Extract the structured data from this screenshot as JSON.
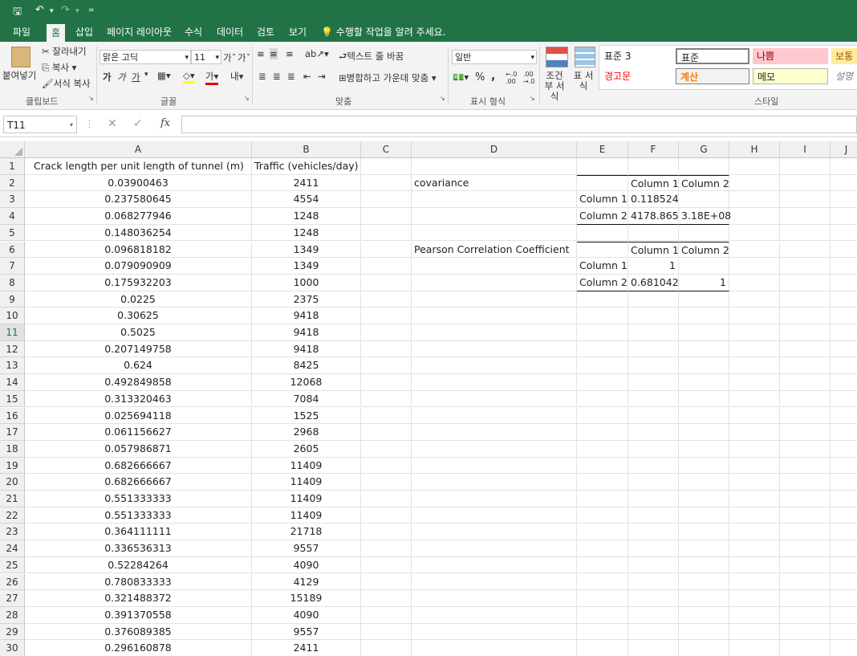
{
  "qat": {
    "save": "🖫",
    "undo": "↶",
    "redo": "↷"
  },
  "tabs": [
    "파일",
    "홈",
    "삽입",
    "페이지 레이아웃",
    "수식",
    "데이터",
    "검토",
    "보기"
  ],
  "tell_me": "수행할 작업을 알려 주세요.",
  "ribbon": {
    "clipboard": {
      "paste": "붙여넣기",
      "cut": "잘라내기",
      "copy": "복사",
      "format_painter": "서식 복사",
      "label": "클립보드"
    },
    "font": {
      "name": "맑은 고딕",
      "size": "11",
      "bold": "가",
      "italic": "가",
      "underline": "가",
      "label": "글꼴"
    },
    "align": {
      "wrap": "텍스트 줄 바꿈",
      "merge": "병합하고 가운데 맞춤",
      "label": "맞춤"
    },
    "number": {
      "format": "일반",
      "percent": "%",
      "comma": ",",
      "label": "표시 형식"
    },
    "styles": {
      "conditional": "조건부 서식",
      "table": "표 서식",
      "items": [
        "표준 3",
        "표준",
        "나쁨",
        "보통",
        "경고문",
        "계산",
        "메모",
        "설명"
      ],
      "label": "스타일"
    }
  },
  "formula_bar": {
    "name_box": "T11",
    "cancel": "✕",
    "enter": "✓",
    "fx": "fx",
    "content": ""
  },
  "columns": [
    "A",
    "B",
    "C",
    "D",
    "E",
    "F",
    "G",
    "H",
    "I",
    "J"
  ],
  "selected_row": 11,
  "rows": [
    {
      "n": "1",
      "a": "Crack length per unit length of tunnel (m)",
      "b": "Traffic (vehicles/day)",
      "d": "",
      "e": "",
      "f": "",
      "g": ""
    },
    {
      "n": "2",
      "a": "0.03900463",
      "b": "2411",
      "d": "covariance",
      "e": "",
      "f": "Column 1",
      "g": "Column 2"
    },
    {
      "n": "3",
      "a": "0.237580645",
      "b": "4554",
      "d": "",
      "e": "Column 1",
      "f": "0.118524",
      "g": ""
    },
    {
      "n": "4",
      "a": "0.068277946",
      "b": "1248",
      "d": "",
      "e": "Column 2",
      "f": "4178.865",
      "g": "3.18E+08"
    },
    {
      "n": "5",
      "a": "0.148036254",
      "b": "1248",
      "d": "",
      "e": "",
      "f": "",
      "g": ""
    },
    {
      "n": "6",
      "a": "0.096818182",
      "b": "1349",
      "d": "Pearson Correlation Coefficient",
      "e": "",
      "f": "Column 1",
      "g": "Column 2"
    },
    {
      "n": "7",
      "a": "0.079090909",
      "b": "1349",
      "d": "",
      "e": "Column 1",
      "f": "1",
      "g": ""
    },
    {
      "n": "8",
      "a": "0.175932203",
      "b": "1000",
      "d": "",
      "e": "Column 2",
      "f": "0.681042",
      "g": "1"
    },
    {
      "n": "9",
      "a": "0.0225",
      "b": "2375",
      "d": "",
      "e": "",
      "f": "",
      "g": ""
    },
    {
      "n": "10",
      "a": "0.30625",
      "b": "9418",
      "d": "",
      "e": "",
      "f": "",
      "g": ""
    },
    {
      "n": "11",
      "a": "0.5025",
      "b": "9418",
      "d": "",
      "e": "",
      "f": "",
      "g": ""
    },
    {
      "n": "12",
      "a": "0.207149758",
      "b": "9418",
      "d": "",
      "e": "",
      "f": "",
      "g": ""
    },
    {
      "n": "13",
      "a": "0.624",
      "b": "8425",
      "d": "",
      "e": "",
      "f": "",
      "g": ""
    },
    {
      "n": "14",
      "a": "0.492849858",
      "b": "12068",
      "d": "",
      "e": "",
      "f": "",
      "g": ""
    },
    {
      "n": "15",
      "a": "0.313320463",
      "b": "7084",
      "d": "",
      "e": "",
      "f": "",
      "g": ""
    },
    {
      "n": "16",
      "a": "0.025694118",
      "b": "1525",
      "d": "",
      "e": "",
      "f": "",
      "g": ""
    },
    {
      "n": "17",
      "a": "0.061156627",
      "b": "2968",
      "d": "",
      "e": "",
      "f": "",
      "g": ""
    },
    {
      "n": "18",
      "a": "0.057986871",
      "b": "2605",
      "d": "",
      "e": "",
      "f": "",
      "g": ""
    },
    {
      "n": "19",
      "a": "0.682666667",
      "b": "11409",
      "d": "",
      "e": "",
      "f": "",
      "g": ""
    },
    {
      "n": "20",
      "a": "0.682666667",
      "b": "11409",
      "d": "",
      "e": "",
      "f": "",
      "g": ""
    },
    {
      "n": "21",
      "a": "0.551333333",
      "b": "11409",
      "d": "",
      "e": "",
      "f": "",
      "g": ""
    },
    {
      "n": "22",
      "a": "0.551333333",
      "b": "11409",
      "d": "",
      "e": "",
      "f": "",
      "g": ""
    },
    {
      "n": "23",
      "a": "0.364111111",
      "b": "21718",
      "d": "",
      "e": "",
      "f": "",
      "g": ""
    },
    {
      "n": "24",
      "a": "0.336536313",
      "b": "9557",
      "d": "",
      "e": "",
      "f": "",
      "g": ""
    },
    {
      "n": "25",
      "a": "0.52284264",
      "b": "4090",
      "d": "",
      "e": "",
      "f": "",
      "g": ""
    },
    {
      "n": "26",
      "a": "0.780833333",
      "b": "4129",
      "d": "",
      "e": "",
      "f": "",
      "g": ""
    },
    {
      "n": "27",
      "a": "0.321488372",
      "b": "15189",
      "d": "",
      "e": "",
      "f": "",
      "g": ""
    },
    {
      "n": "28",
      "a": "0.391370558",
      "b": "4090",
      "d": "",
      "e": "",
      "f": "",
      "g": ""
    },
    {
      "n": "29",
      "a": "0.376089385",
      "b": "9557",
      "d": "",
      "e": "",
      "f": "",
      "g": ""
    },
    {
      "n": "30",
      "a": "0.296160878",
      "b": "2411",
      "d": "",
      "e": "",
      "f": "",
      "g": ""
    }
  ]
}
